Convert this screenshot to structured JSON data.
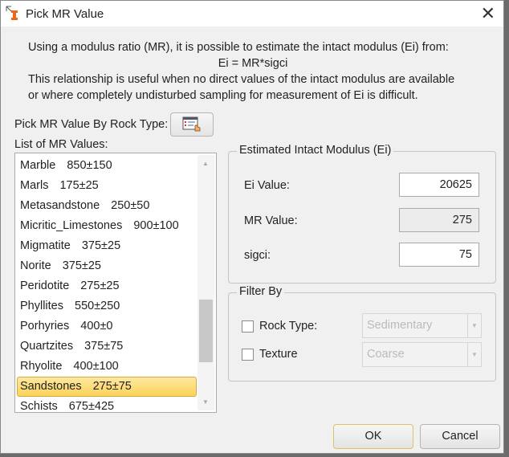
{
  "window": {
    "title": "Pick MR Value"
  },
  "description": {
    "line1": "Using a modulus ratio (MR), it is possible to estimate the intact modulus (Ei) from:",
    "formula": "Ei = MR*sigci",
    "line3": "This relationship is useful when no direct values of the intact modulus are available",
    "line4": "or where completely undisturbed sampling for measurement of Ei is difficult."
  },
  "pick_by_rock_type_label": "Pick MR Value By Rock Type:",
  "list_label": "List of MR Values:",
  "list_items": [
    {
      "name": "Marble",
      "value": "850±150"
    },
    {
      "name": "Marls",
      "value": "175±25"
    },
    {
      "name": "Metasandstone",
      "value": "250±50"
    },
    {
      "name": "Micritic_Limestones",
      "value": "900±100"
    },
    {
      "name": "Migmatite",
      "value": "375±25"
    },
    {
      "name": "Norite",
      "value": "375±25"
    },
    {
      "name": "Peridotite",
      "value": "275±25"
    },
    {
      "name": "Phyllites",
      "value": "550±250"
    },
    {
      "name": "Porhyries",
      "value": "400±0"
    },
    {
      "name": "Quartzites",
      "value": "375±75"
    },
    {
      "name": "Rhyolite",
      "value": "400±100"
    },
    {
      "name": "Sandstones",
      "value": "275±75"
    },
    {
      "name": "Schists",
      "value": "675±425"
    }
  ],
  "selected_index": 11,
  "estimate_group": {
    "title": "Estimated Intact Modulus (Ei)",
    "ei_label": "Ei Value:",
    "ei_value": "20625",
    "mr_label": "MR Value:",
    "mr_value": "275",
    "sigci_label": "sigci:",
    "sigci_value": "75"
  },
  "filter_group": {
    "title": "Filter By",
    "rock_type_label": "Rock Type:",
    "rock_type_value": "Sedimentary",
    "texture_label": "Texture",
    "texture_value": "Coarse"
  },
  "buttons": {
    "ok": "OK",
    "cancel": "Cancel"
  }
}
